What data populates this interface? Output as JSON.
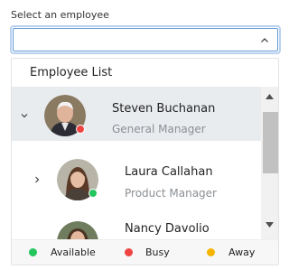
{
  "field": {
    "label": "Select an employee",
    "value": "",
    "placeholder": ""
  },
  "popup": {
    "header": "Employee List",
    "items": [
      {
        "name": "Steven Buchanan",
        "role": "General Manager",
        "status": "busy",
        "expanded": true,
        "selected": true
      },
      {
        "name": "Laura Callahan",
        "role": "Product Manager",
        "status": "available",
        "expanded": false,
        "selected": false
      },
      {
        "name": "Nancy Davolio",
        "role": "",
        "status": "",
        "expanded": false,
        "selected": false
      }
    ],
    "scroll_fraction": 0.0
  },
  "legend": [
    {
      "label": "Available",
      "color": "#22c55e"
    },
    {
      "label": "Busy",
      "color": "#ef4444"
    },
    {
      "label": "Away",
      "color": "#f5b400"
    }
  ],
  "colors": {
    "selected_row": "#e9ecef",
    "input_border": "#5e9ad9",
    "status_available": "#22c55e",
    "status_busy": "#ef4444",
    "status_away": "#f5b400"
  },
  "icons": {
    "dropdown": "chevron-up-icon",
    "expanded": "chevron-down-icon",
    "collapsed": "chevron-right-icon",
    "scroll_up": "triangle-up-icon",
    "scroll_down": "triangle-down-icon"
  }
}
